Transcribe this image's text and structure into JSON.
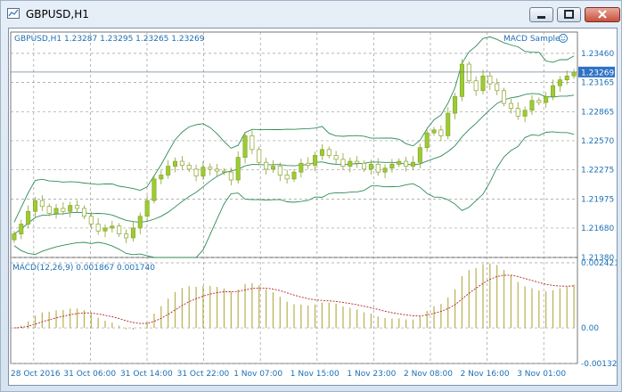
{
  "window": {
    "title": "GBPUSD,H1"
  },
  "chart": {
    "header": {
      "symbol_line": "GBPUSD,H1  1.23287 1.23295 1.23265 1.23269",
      "indicator_name": "MACD Sample"
    },
    "sub_window": {
      "label": "MACD(12,26,9) 0.001867 0.001740"
    },
    "current_price_label": "1.23269",
    "colors": {
      "bull": "#9acd32",
      "bear": "#8aa22a",
      "bands": "#2e8b57",
      "macd_bar": "#b8b050",
      "signal": "#b22222",
      "grid": "#9c9c9c",
      "label": "#1a6fb5"
    }
  },
  "chart_data": [
    {
      "type": "candlestick",
      "title": "GBPUSD,H1",
      "y_ticks": [
        "1.23460",
        "1.23165",
        "1.22865",
        "1.22570",
        "1.22275",
        "1.21975",
        "1.21680",
        "1.21380"
      ],
      "ylim": [
        1.2138,
        1.2355
      ],
      "x_ticks": [
        "28 Oct 2016",
        "31 Oct 06:00",
        "31 Oct 14:00",
        "31 Oct 22:00",
        "1 Nov 07:00",
        "1 Nov 15:00",
        "1 Nov 23:00",
        "2 Nov 08:00",
        "2 Nov 16:00",
        "3 Nov 01:00"
      ],
      "closes": [
        1.2162,
        1.2172,
        1.2185,
        1.2196,
        1.219,
        1.2183,
        1.2188,
        1.2185,
        1.2191,
        1.2188,
        1.218,
        1.2172,
        1.2165,
        1.2168,
        1.217,
        1.2162,
        1.2158,
        1.2168,
        1.218,
        1.2196,
        1.2218,
        1.2222,
        1.2231,
        1.2236,
        1.2232,
        1.2228,
        1.2221,
        1.223,
        1.2228,
        1.2226,
        1.2225,
        1.2217,
        1.224,
        1.2262,
        1.2248,
        1.2235,
        1.2228,
        1.2231,
        1.2222,
        1.2218,
        1.2225,
        1.2234,
        1.2232,
        1.2242,
        1.2248,
        1.2242,
        1.2238,
        1.2231,
        1.2236,
        1.2234,
        1.2228,
        1.2233,
        1.2225,
        1.2229,
        1.2233,
        1.2236,
        1.2231,
        1.2235,
        1.225,
        1.2265,
        1.2268,
        1.2262,
        1.2285,
        1.2302,
        1.2335,
        1.2318,
        1.2308,
        1.2323,
        1.2315,
        1.2308,
        1.2295,
        1.229,
        1.2282,
        1.2288,
        1.2298,
        1.2296,
        1.2302,
        1.2313,
        1.2319,
        1.2323,
        1.2327
      ]
    },
    {
      "type": "bar",
      "title": "MACD(12,26,9)",
      "y_ticks": [
        "0.002421",
        "0.00",
        "-0.001323"
      ],
      "ylim": [
        -0.001323,
        0.002421
      ]
    }
  ]
}
